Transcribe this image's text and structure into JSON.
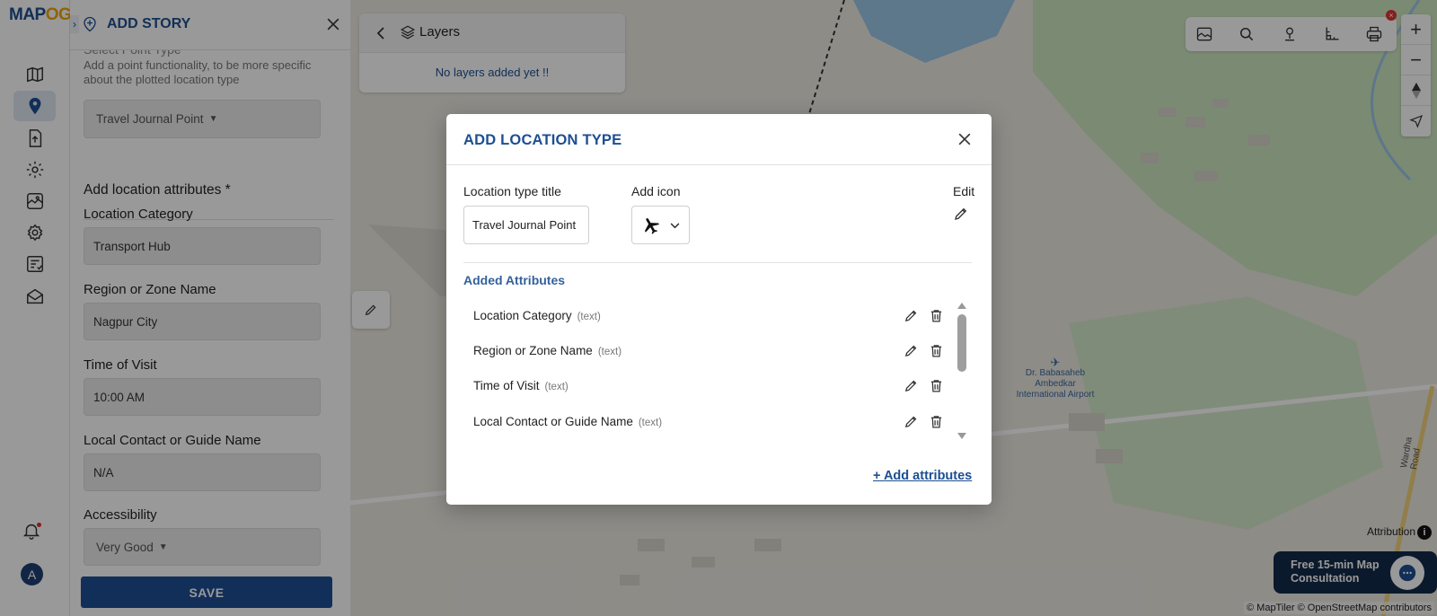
{
  "logo": {
    "text_map": "MAP",
    "text_og": "OG"
  },
  "rail": {
    "icons": [
      "map-icon",
      "location-pin-icon",
      "upload-icon",
      "settings-gear-icon",
      "map-gallery-icon",
      "cog-icon",
      "report-icon",
      "mail-icon"
    ],
    "active": "location-pin-icon",
    "avatar_initial": "A"
  },
  "story": {
    "title": "ADD STORY",
    "cut_label": "Select Point Type",
    "help_text": "Add a point functionality, to be more specific about the plotted location type",
    "point_type": "Travel Journal Point",
    "attributes_heading": "Add location attributes *",
    "fields": [
      {
        "label": "Location Category",
        "value": "Transport Hub"
      },
      {
        "label": "Region or Zone Name",
        "value": "Nagpur City"
      },
      {
        "label": "Time of Visit",
        "value": "10:00 AM"
      },
      {
        "label": "Local Contact or Guide Name",
        "value": "N/A"
      }
    ],
    "accessibility_label": "Accessibility",
    "accessibility_value": "Very Good",
    "save_label": "SAVE"
  },
  "layers": {
    "title": "Layers",
    "empty_text": "No layers added yet !!"
  },
  "map": {
    "airport_label_1": "Dr. Babasaheb",
    "airport_label_2": "Ambedkar",
    "airport_label_3": "International Airport",
    "road_label": "Wardha Road",
    "attribution": "Attribution",
    "attribution_icon": "i",
    "consult_text": "Free 15-min Map Consultation",
    "credit": "© MapTiler © OpenStreetMap contributors",
    "zoom_in": "+",
    "zoom_out": "−"
  },
  "modal": {
    "title": "ADD LOCATION TYPE",
    "type_title_label": "Location type title",
    "type_title_value": "Travel Journal Point",
    "add_icon_label": "Add icon",
    "selected_icon": "airplane-icon",
    "edit_label": "Edit",
    "added_attributes_label": "Added Attributes",
    "attributes": [
      {
        "name": "Location Category",
        "type": "(text)"
      },
      {
        "name": "Region or Zone Name",
        "type": "(text)"
      },
      {
        "name": "Time of Visit",
        "type": "(text)"
      },
      {
        "name": "Local Contact or Guide Name",
        "type": "(text)"
      }
    ],
    "add_attributes_link": "+ Add attributes"
  },
  "colors": {
    "brand_blue": "#1d4f91",
    "save_button": "#1f4f94",
    "water": "#9cc6e8",
    "park": "#cde6c0"
  }
}
